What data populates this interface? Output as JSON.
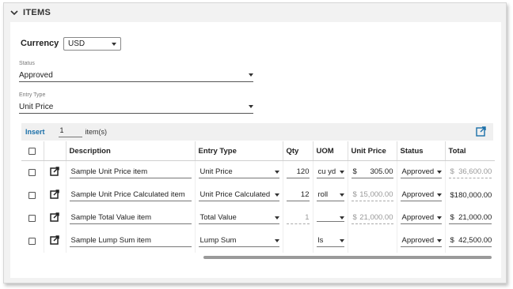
{
  "section": {
    "title": "ITEMS"
  },
  "currency": {
    "label": "Currency",
    "value": "USD"
  },
  "status": {
    "label": "Status",
    "value": "Approved"
  },
  "entry_type": {
    "label": "Entry Type",
    "value": "Unit Price"
  },
  "toolbar": {
    "insert_label": "Insert",
    "insert_count": "1",
    "items_label": "item(s)"
  },
  "table": {
    "headers": {
      "description": "Description",
      "entry_type": "Entry Type",
      "qty": "Qty",
      "uom": "UOM",
      "unit_price": "Unit Price",
      "status": "Status",
      "total": "Total"
    },
    "rows": [
      {
        "description": "Sample Unit Price item",
        "entry_type": "Unit Price",
        "qty": "120",
        "uom": "cu yd",
        "unit_price": "305.00",
        "status": "Approved",
        "total": "36,600.00"
      },
      {
        "description": "Sample Unit Price Calculated item",
        "entry_type": "Unit Price Calculated",
        "qty": "12",
        "uom": "roll",
        "unit_price": "15,000.00",
        "status": "Approved",
        "total": "$180,000.00"
      },
      {
        "description": "Sample Total Value item",
        "entry_type": "Total Value",
        "qty": "1",
        "uom": "",
        "unit_price": "21,000.00",
        "status": "Approved",
        "total": "21,000.00"
      },
      {
        "description": "Sample Lump Sum item",
        "entry_type": "Lump Sum",
        "qty": "",
        "uom": "ls",
        "unit_price": "",
        "status": "Approved",
        "total": "42,500.00"
      }
    ],
    "currency_symbol": "$"
  },
  "colors": {
    "link": "#1a6fa8",
    "panel_bg": "#f2f2f2"
  }
}
